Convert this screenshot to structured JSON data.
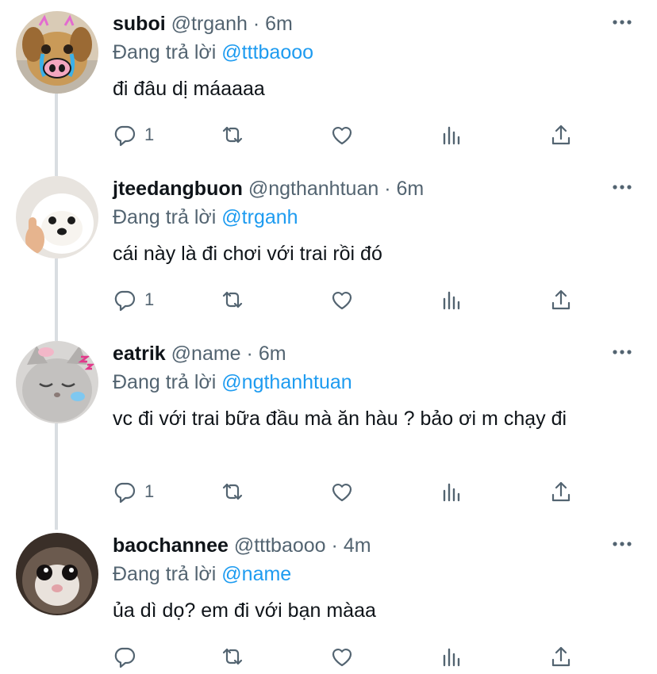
{
  "reply_label": "Đang trả lời",
  "tweets": [
    {
      "name": "suboi",
      "handle": "@trganh",
      "time": "6m",
      "replying_to": "@tttbaooo",
      "text": "đi đâu dị máaaaa",
      "reply_count": "1",
      "avatar": "dog-crying-pig-nose-avatar"
    },
    {
      "name": "jteedangbuon",
      "handle": "@ngthanhtuan",
      "time": "6m",
      "replying_to": "@trganh",
      "text": "cái này là đi chơi với trai rồi đó",
      "reply_count": "1",
      "avatar": "white-puppy-thumbs-up-avatar"
    },
    {
      "name": "eatrik",
      "handle": "@name",
      "time": "6m",
      "replying_to": "@ngthanhtuan",
      "text": "vc đi với trai bữa đầu mà ăn hàu ? bảo ơi m chạy đi",
      "reply_count": "1",
      "avatar": "sleepy-gray-cat-avatar"
    },
    {
      "name": "baochannee",
      "handle": "@tttbaooo",
      "time": "4m",
      "replying_to": "@name",
      "text": "ủa dì dọ? em đi với bạn màaa",
      "reply_count": "",
      "avatar": "monkey-face-avatar"
    }
  ],
  "colors": {
    "name": "#0f1419",
    "meta": "#536471",
    "mention": "#1d9bf0",
    "thread_line": "#d9dde1"
  }
}
